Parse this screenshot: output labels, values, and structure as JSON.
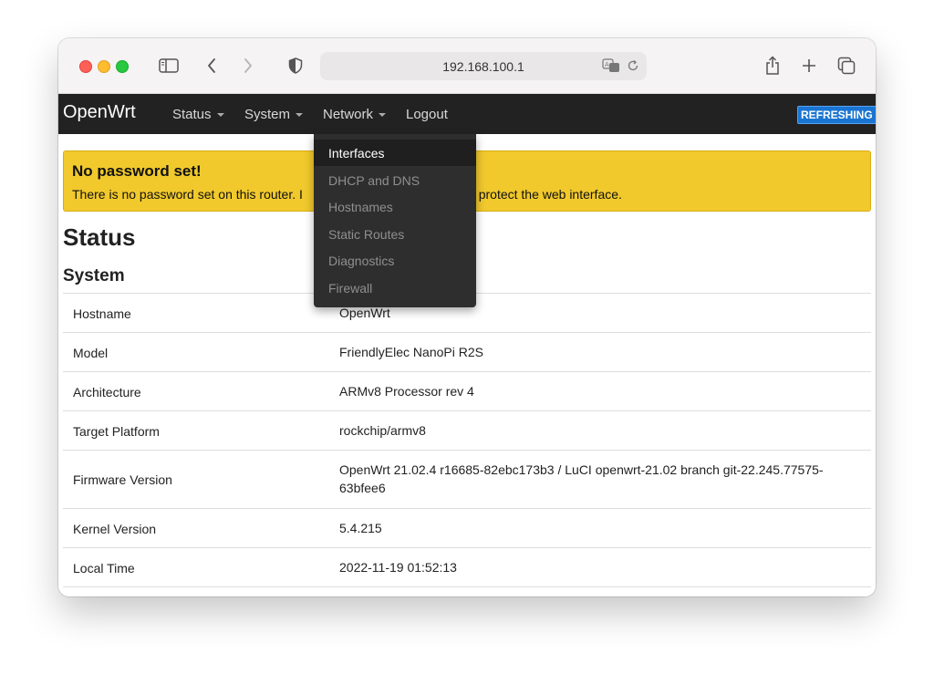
{
  "browser": {
    "url": "192.168.100.1"
  },
  "navbar": {
    "brand": "OpenWrt",
    "items": [
      {
        "label": "Status"
      },
      {
        "label": "System"
      },
      {
        "label": "Network"
      },
      {
        "label": "Logout"
      }
    ],
    "badge": "REFRESHING"
  },
  "dropdown": {
    "items": [
      {
        "label": "Interfaces",
        "active": true
      },
      {
        "label": "DHCP and DNS"
      },
      {
        "label": "Hostnames"
      },
      {
        "label": "Static Routes"
      },
      {
        "label": "Diagnostics"
      },
      {
        "label": "Firewall"
      }
    ]
  },
  "alert": {
    "title": "No password set!",
    "text_left": "There is no password set on this router. I",
    "text_right": "ssword to protect the web interface."
  },
  "page": {
    "title": "Status",
    "section": "System"
  },
  "system_table": [
    {
      "key": "Hostname",
      "value": "OpenWrt"
    },
    {
      "key": "Model",
      "value": "FriendlyElec NanoPi R2S"
    },
    {
      "key": "Architecture",
      "value": "ARMv8 Processor rev 4"
    },
    {
      "key": "Target Platform",
      "value": "rockchip/armv8"
    },
    {
      "key": "Firmware Version",
      "value": "OpenWrt 21.02.4 r16685-82ebc173b3 / LuCI openwrt-21.02 branch git-22.245.77575-63bfee6"
    },
    {
      "key": "Kernel Version",
      "value": "5.4.215"
    },
    {
      "key": "Local Time",
      "value": "2022-11-19 01:52:13"
    }
  ],
  "colors": {
    "navbar": "#222222",
    "alert": "#f1c92c",
    "badge": "#1a75d2"
  }
}
